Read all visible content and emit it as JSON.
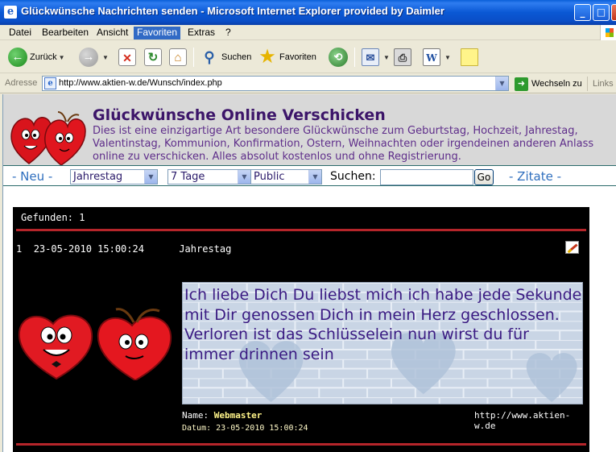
{
  "window": {
    "title": "Glückwünsche Nachrichten senden - Microsoft Internet Explorer provided by Daimler",
    "minimize_glyph": "_",
    "maximize_glyph": "□",
    "close_glyph": "×"
  },
  "menubar": {
    "items": [
      "Datei",
      "Bearbeiten",
      "Ansicht",
      "Favoriten",
      "Extras",
      "?"
    ],
    "active": "Favoriten"
  },
  "toolbar": {
    "back_label": "Zurück",
    "search_label": "Suchen",
    "favorites_label": "Favoriten"
  },
  "address": {
    "label": "Adresse",
    "url": "http://www.aktien-w.de/Wunsch/index.php",
    "go_label": "Wechseln zu",
    "links_label": "Links"
  },
  "site": {
    "title": "Glückwünsche Online Verschicken",
    "description": "Dies ist eine einzigartige Art besondere Glückwünsche zum Geburtstag, Hochzeit, Jahrestag, Valentinstag, Kommunion, Konfirmation, Ostern, Weihnachten oder irgendeinen anderen Anlass online zu verschicken. Alles absolut kostenlos und ohne Registrierung."
  },
  "nav": {
    "new_link": "- Neu -",
    "quotes_link": "- Zitate -",
    "occasion_select": "Jahrestag",
    "period_select": "7 Tage",
    "visibility_select": "Public",
    "search_label": "Suchen:",
    "search_value": "",
    "go_button": "Go"
  },
  "results": {
    "found_label": "Gefunden:",
    "found_count": "1",
    "entries": [
      {
        "index": "1",
        "datetime": "23-05-2010 15:00:24",
        "occasion": "Jahrestag",
        "message_line1": "Ich liebe Dich Du liebst mich ich habe jede Sekunde mit Dir genossen Dich in mein Herz geschlossen.",
        "message_line2": "Verloren ist das Schlüsselein nun wirst du für immer drinnen sein",
        "name_label": "Name:",
        "name": "Webmaster",
        "website": "http://www.aktien-w.de",
        "date_label": "Datum:",
        "date": "23-05-2010 15:00:24"
      }
    ]
  },
  "colors": {
    "titlebar": "#0A58D4",
    "site_title": "#3C1569",
    "site_desc": "#5E2D8A",
    "nav_link": "#2E6EBE",
    "results_bg": "#000000",
    "divider_red": "#B5252A",
    "message_text": "#3A1A82"
  }
}
